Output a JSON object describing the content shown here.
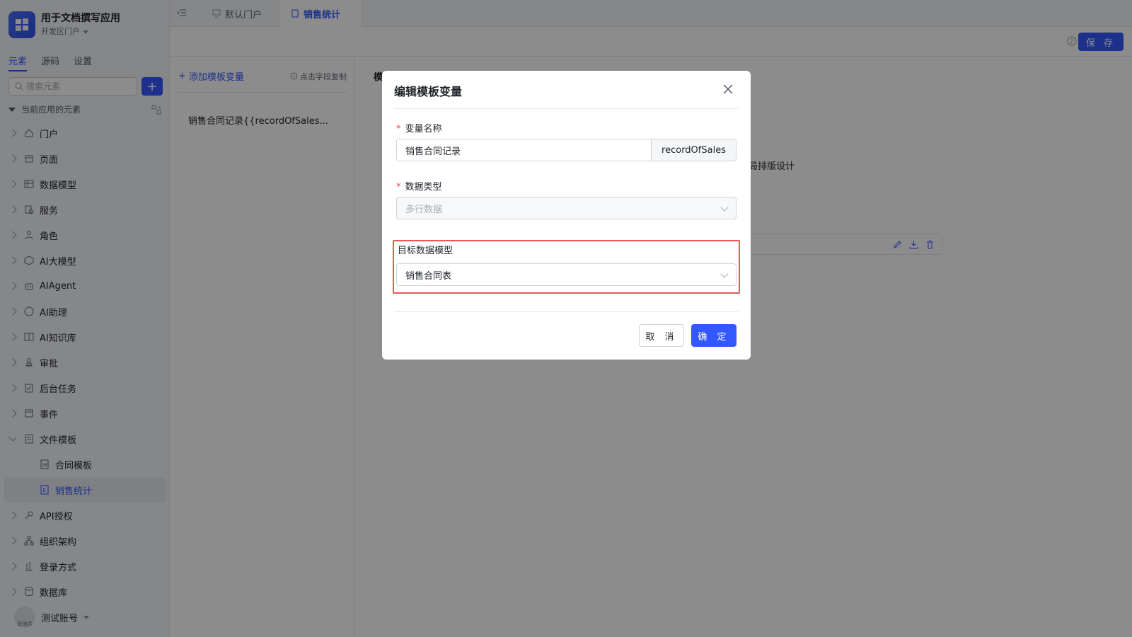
{
  "app": {
    "title": "用于文档撰写应用",
    "portal": "开发区门户"
  },
  "sidebar": {
    "tabs": [
      {
        "label": "元素"
      },
      {
        "label": "源码"
      },
      {
        "label": "设置"
      }
    ],
    "search_placeholder": "搜索元素",
    "tree_title": "当前应用的元素",
    "items": [
      {
        "label": "门户",
        "icon": "home-icon"
      },
      {
        "label": "页面",
        "icon": "page-icon"
      },
      {
        "label": "数据模型",
        "icon": "table-icon"
      },
      {
        "label": "服务",
        "icon": "service-icon"
      },
      {
        "label": "角色",
        "icon": "role-icon"
      },
      {
        "label": "AI大模型",
        "icon": "ai-model-icon"
      },
      {
        "label": "AIAgent",
        "icon": "robot-icon"
      },
      {
        "label": "AI助理",
        "icon": "ai-assistant-icon"
      },
      {
        "label": "AI知识库",
        "icon": "book-icon"
      },
      {
        "label": "审批",
        "icon": "approval-icon"
      },
      {
        "label": "后台任务",
        "icon": "task-icon"
      },
      {
        "label": "事件",
        "icon": "event-icon"
      },
      {
        "label": "文件模板",
        "icon": "file-template-icon"
      },
      {
        "label": "合同模板",
        "icon": "word-file-icon"
      },
      {
        "label": "销售统计",
        "icon": "excel-file-icon"
      },
      {
        "label": "API授权",
        "icon": "api-key-icon"
      },
      {
        "label": "组织架构",
        "icon": "org-icon"
      },
      {
        "label": "登录方式",
        "icon": "login-icon"
      },
      {
        "label": "数据库",
        "icon": "database-icon"
      }
    ],
    "user": {
      "name": "测试账号",
      "avatar_text": "管理员"
    }
  },
  "topbar": {
    "tabs": [
      {
        "label": "默认门户"
      },
      {
        "label": "销售统计"
      }
    ],
    "save_label": "保 存"
  },
  "variables": {
    "add_label": "添加模板变量",
    "copy_hint": "点击字段复制",
    "items": [
      "销售合同记录{{recordOfSales..."
    ]
  },
  "work": {
    "heading": "模",
    "text": "局排版设计"
  },
  "modal": {
    "title": "编辑模板变量",
    "name_label": "变量名称",
    "name_value": "销售合同记录",
    "name_code": "recordOfSales",
    "type_label": "数据类型",
    "type_value": "多行数据",
    "target_label": "目标数据模型",
    "target_value": "销售合同表",
    "cancel_label": "取 消",
    "ok_label": "确 定"
  },
  "colors": {
    "accent": "#3358ff",
    "highlight": "#f05454",
    "required": "#f53f3f"
  }
}
